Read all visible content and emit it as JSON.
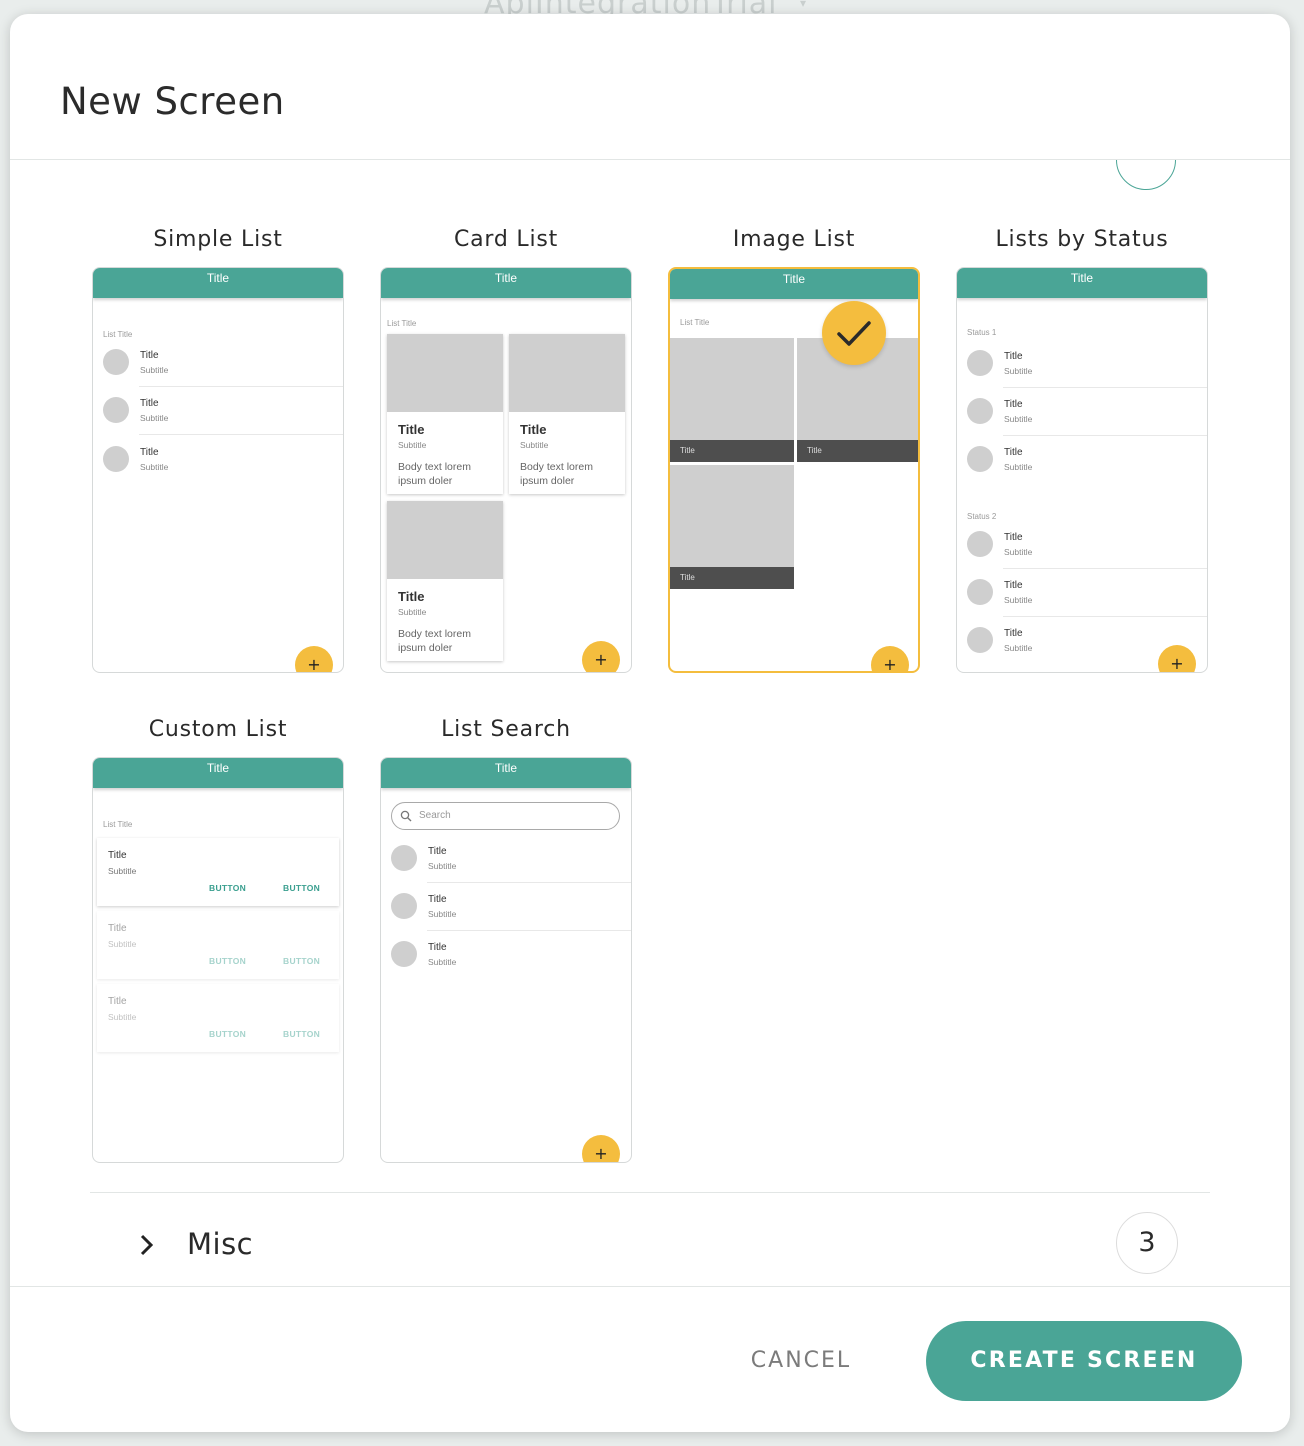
{
  "background": {
    "app_name": "ApiIntegrationTrial"
  },
  "dialog": {
    "title": "New Screen"
  },
  "templates": [
    {
      "name": "Simple List",
      "bar_title": "Title",
      "list_title": "List Title",
      "rows": [
        {
          "title": "Title",
          "subtitle": "Subtitle"
        },
        {
          "title": "Title",
          "subtitle": "Subtitle"
        },
        {
          "title": "Title",
          "subtitle": "Subtitle"
        }
      ],
      "fab": "+"
    },
    {
      "name": "Card List",
      "bar_title": "Title",
      "list_title": "List Title",
      "cards": [
        {
          "title": "Title",
          "subtitle": "Subtitle",
          "body": "Body text lorem ipsum doler"
        },
        {
          "title": "Title",
          "subtitle": "Subtitle",
          "body": "Body text lorem ipsum doler"
        },
        {
          "title": "Title",
          "subtitle": "Subtitle",
          "body": "Body text lorem ipsum doler"
        }
      ],
      "fab": "+"
    },
    {
      "name": "Image List",
      "bar_title": "Title",
      "list_title": "List Title",
      "tiles": [
        {
          "caption": "Title"
        },
        {
          "caption": "Title"
        },
        {
          "caption": "Title"
        }
      ],
      "fab": "+",
      "selected": true
    },
    {
      "name": "Lists by Status",
      "bar_title": "Title",
      "groups": [
        {
          "label": "Status 1",
          "rows": [
            {
              "title": "Title",
              "subtitle": "Subtitle"
            },
            {
              "title": "Title",
              "subtitle": "Subtitle"
            },
            {
              "title": "Title",
              "subtitle": "Subtitle"
            }
          ]
        },
        {
          "label": "Status 2",
          "rows": [
            {
              "title": "Title",
              "subtitle": "Subtitle"
            },
            {
              "title": "Title",
              "subtitle": "Subtitle"
            },
            {
              "title": "Title",
              "subtitle": "Subtitle"
            }
          ]
        }
      ],
      "fab": "+"
    },
    {
      "name": "Custom List",
      "bar_title": "Title",
      "list_title": "List Title",
      "cards": [
        {
          "title": "Title",
          "subtitle": "Subtitle",
          "button1": "BUTTON",
          "button2": "BUTTON"
        },
        {
          "title": "Title",
          "subtitle": "Subtitle",
          "button1": "BUTTON",
          "button2": "BUTTON"
        },
        {
          "title": "Title",
          "subtitle": "Subtitle",
          "button1": "BUTTON",
          "button2": "BUTTON"
        }
      ]
    },
    {
      "name": "List Search",
      "bar_title": "Title",
      "search_placeholder": "Search",
      "rows": [
        {
          "title": "Title",
          "subtitle": "Subtitle"
        },
        {
          "title": "Title",
          "subtitle": "Subtitle"
        },
        {
          "title": "Title",
          "subtitle": "Subtitle"
        }
      ],
      "fab": "+"
    }
  ],
  "misc_section": {
    "label": "Misc",
    "count": "3"
  },
  "actions": {
    "cancel": "CANCEL",
    "create": "CREATE SCREEN"
  },
  "colors": {
    "accent": "#4aa596",
    "highlight": "#f4bd3e",
    "placeholder": "#cfcfcf"
  },
  "icons": {
    "selected_check": "check-icon",
    "expand": "chevron-right-icon",
    "search": "search-icon"
  }
}
